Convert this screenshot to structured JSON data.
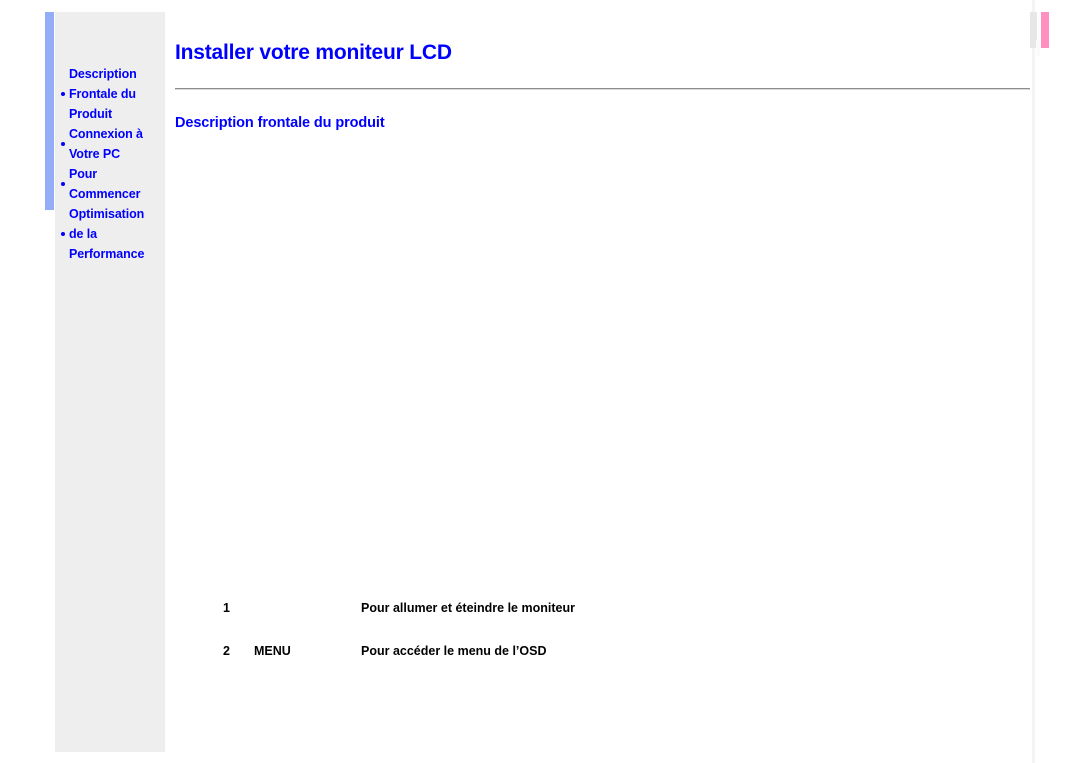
{
  "document": {
    "title": "Installer votre moniteur LCD",
    "section_heading": "Description frontale du produit"
  },
  "sidebar": {
    "items": [
      {
        "label": "Description Frontale du Produit"
      },
      {
        "label": "Connexion à Votre PC"
      },
      {
        "label": "Pour Commencer"
      },
      {
        "label": "Optimisation de la Performance"
      }
    ]
  },
  "legend": {
    "rows": [
      {
        "index": "1",
        "control": "",
        "description": "Pour allumer et éteindre le moniteur"
      },
      {
        "index": "2",
        "control": "MENU",
        "description": "Pour accéder le menu de l’OSD"
      }
    ]
  },
  "colors": {
    "link_blue": "#0000ff",
    "accent_bar_blue": "#93aef6",
    "sidebar_background": "#eeeeee",
    "marker_pink": "#ff8fc0",
    "marker_gray": "#e7e7e9"
  }
}
